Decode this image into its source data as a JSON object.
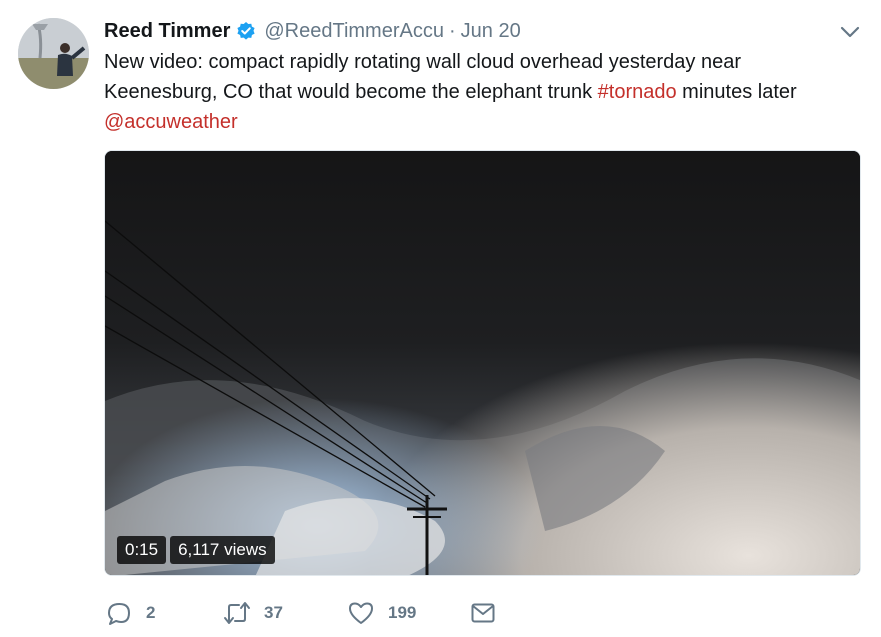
{
  "author": {
    "name": "Reed Timmer",
    "handle": "@ReedTimmerAccu",
    "separator": "·",
    "date": "Jun 20",
    "verified": true
  },
  "tweet": {
    "text_plain": "New video: compact rapidly rotating wall cloud overhead yesterday near Keenesburg, CO that would become the elephant trunk ",
    "hashtag": "#tornado",
    "text_after": " minutes later ",
    "mention": "@accuweather"
  },
  "media": {
    "duration": "0:15",
    "views": "6,117 views"
  },
  "actions": {
    "replies": "2",
    "retweets": "37",
    "likes": "199"
  },
  "colors": {
    "link": "#c4302b",
    "muted": "#657786",
    "verified": "#1da1f2"
  },
  "icons": [
    "verified-badge-icon",
    "chevron-down-icon",
    "reply-icon",
    "retweet-icon",
    "like-icon",
    "direct-message-icon"
  ]
}
